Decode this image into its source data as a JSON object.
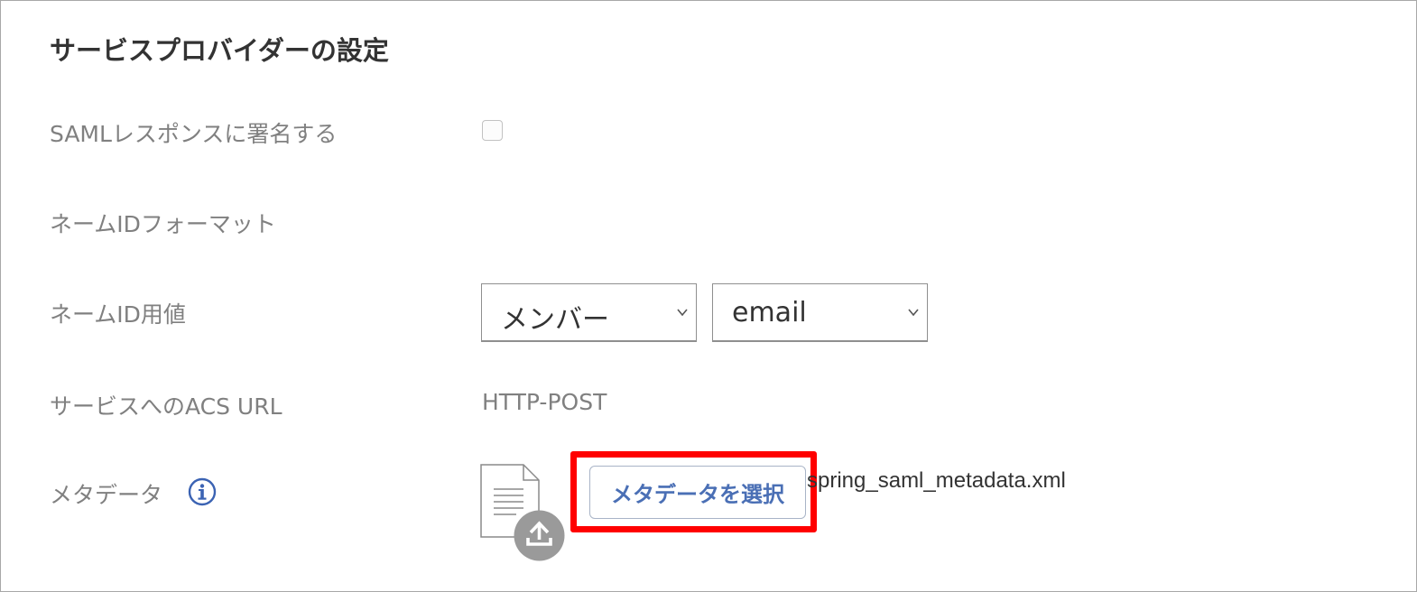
{
  "section": {
    "title": "サービスプロバイダーの設定"
  },
  "rows": {
    "sign_response": {
      "label": "SAMLレスポンスに署名する",
      "checked": false
    },
    "nameid_format": {
      "label": "ネームIDフォーマット"
    },
    "nameid_value": {
      "label": "ネームID用値",
      "select_source": "メンバー",
      "select_attribute": "email"
    },
    "acs_url": {
      "label": "サービスへのACS URL",
      "value": "HTTP-POST"
    },
    "metadata": {
      "label": "メタデータ",
      "button_label": "メタデータを選択",
      "filename": "spring_saml_metadata.xml"
    }
  },
  "icons": {
    "info": "info-circle-icon",
    "file": "document-icon",
    "upload": "upload-icon",
    "chevron": "chevron-down-icon"
  },
  "colors": {
    "highlight": "#ff0000",
    "button_text": "#4a6fb5",
    "info_icon": "#3b63b3",
    "upload_bg": "#9a9a9a"
  }
}
